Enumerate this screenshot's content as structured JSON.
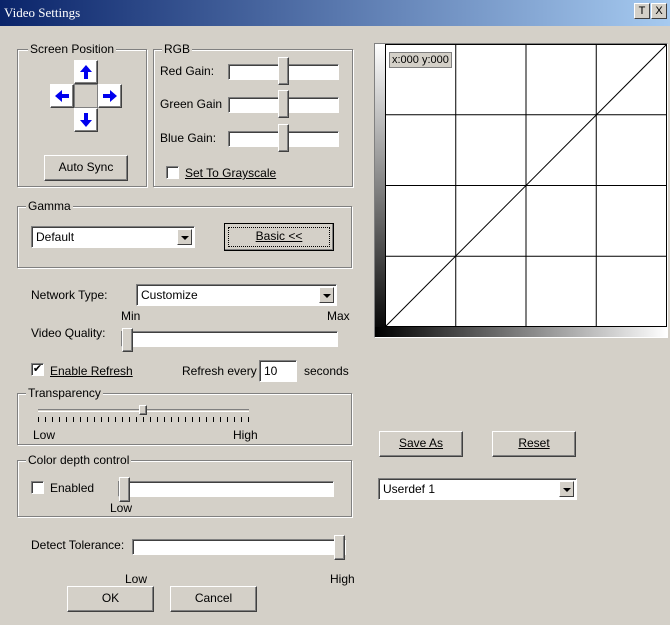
{
  "window": {
    "title": "Video Settings",
    "pin_label": "T",
    "close_label": "X"
  },
  "screen_position": {
    "legend": "Screen Position",
    "up_icon": "arrow-up-icon",
    "left_icon": "arrow-left-icon",
    "right_icon": "arrow-right-icon",
    "down_icon": "arrow-down-icon",
    "auto_sync_label": "Auto Sync"
  },
  "rgb": {
    "legend": "RGB",
    "red_label": "Red Gain:",
    "green_label": "Green Gain",
    "blue_label": "Blue Gain:",
    "red_level": 0.5,
    "green_level": 0.5,
    "blue_level": 0.5,
    "grayscale_label": "Set To Grayscale",
    "grayscale_checked": false
  },
  "gamma": {
    "legend": "Gamma",
    "selected": "Default",
    "basic_label": "Basic <<"
  },
  "network": {
    "label": "Network Type:",
    "selected": "Customize",
    "min_label": "Min",
    "max_label": "Max",
    "quality_label": "Video Quality:",
    "quality_level": 0.0
  },
  "refresh": {
    "enable_label": "Enable Refresh",
    "enabled": true,
    "check_mark": "✔",
    "every_label": "Refresh every",
    "value": "10",
    "unit_label": "seconds"
  },
  "transparency": {
    "legend": "Transparency",
    "low_label": "Low",
    "high_label": "High",
    "level": 0.5
  },
  "color_depth": {
    "legend": "Color depth control",
    "enabled_label": "Enabled",
    "enabled": false,
    "low_label": "Low",
    "level": 0.0
  },
  "detect": {
    "label": "Detect Tolerance:",
    "low_label": "Low",
    "high_label": "High",
    "level": 1.0
  },
  "footer": {
    "ok_label": "OK",
    "cancel_label": "Cancel"
  },
  "graph": {
    "coord_label": "x:000 y:000",
    "save_as_label": "Save As",
    "reset_label": "Reset",
    "profile_selected": "Userdef 1"
  }
}
